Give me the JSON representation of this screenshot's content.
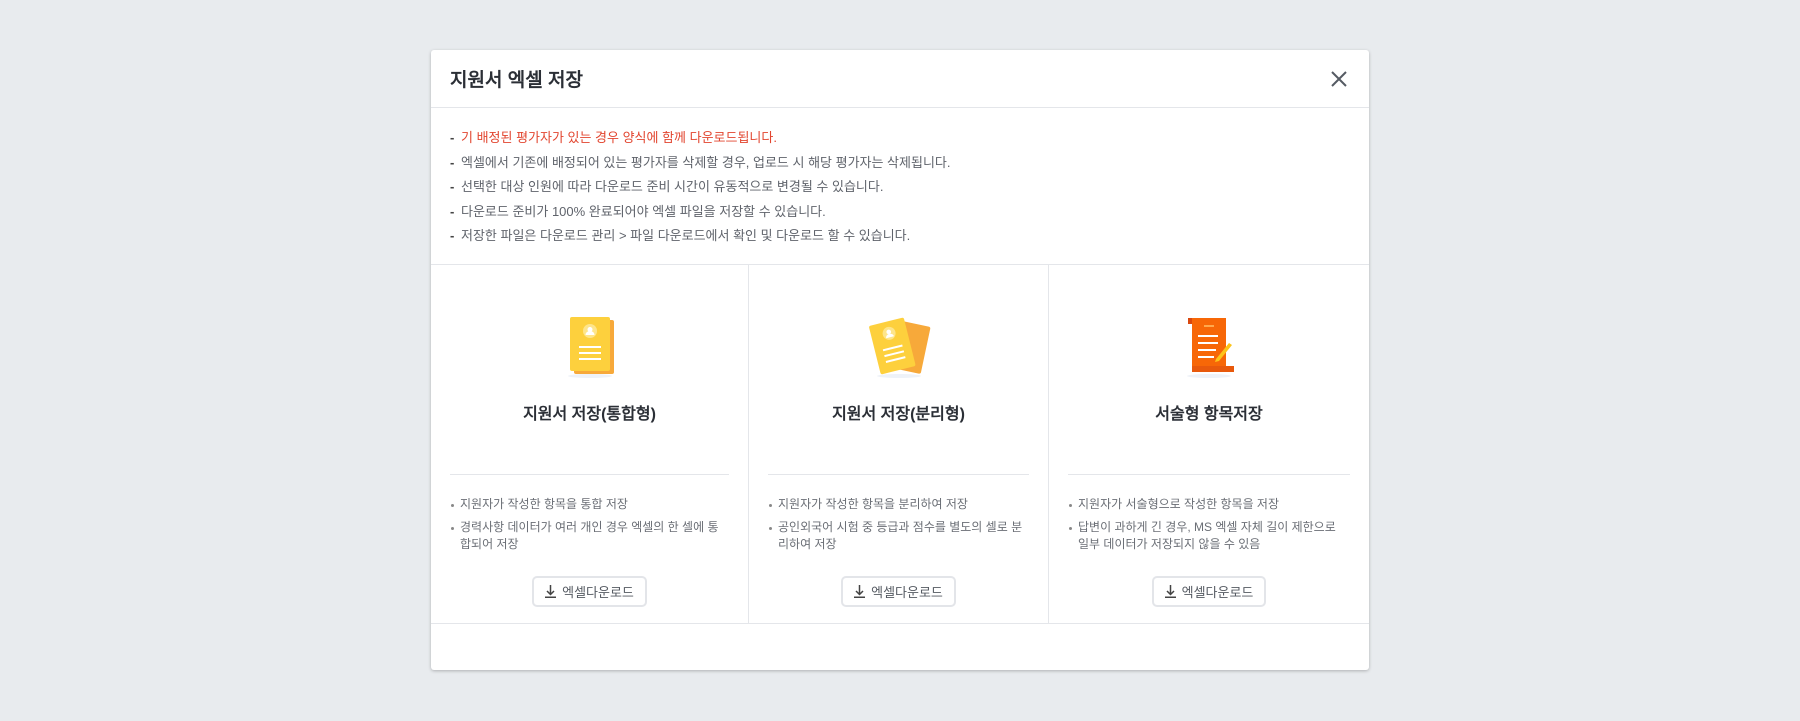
{
  "modal": {
    "title": "지원서 엑셀 저장",
    "close_icon": "close-icon"
  },
  "notices": [
    {
      "text": "기 배정된 평가자가 있는 경우 양식에 함께 다운로드됩니다.",
      "color": "#e2452f"
    },
    {
      "text": "엑셀에서 기존에 배정되어 있는 평가자를 삭제할 경우, 업로드 시 해당 평가자는 삭제됩니다."
    },
    {
      "text": "선택한 대상 인원에 따라 다운로드 준비 시간이 유동적으로 변경될 수 있습니다."
    },
    {
      "text": "다운로드 준비가 100% 완료되어야 엑셀 파일을 저장할 수 있습니다."
    },
    {
      "text": "저장한 파일은 다운로드 관리 > 파일 다운로드에서 확인 및 다운로드 할 수 있습니다."
    }
  ],
  "dash": "-",
  "options": [
    {
      "title": "지원서 저장(통합형)",
      "icon": "resume-document-icon",
      "bullets": [
        "지원자가 작성한 항목을 통합 저장",
        "경력사항 데이터가 여러 개인 경우 엑셀의 한 셀에 통합되어 저장"
      ],
      "button": "엑셀다운로드"
    },
    {
      "title": "지원서 저장(분리형)",
      "icon": "separated-documents-icon",
      "bullets": [
        "지원자가 작성한 항목을 분리하여 저장",
        "공인외국어 시험 중 등급과 점수를 별도의 셀로 분리하여 저장"
      ],
      "button": "엑셀다운로드"
    },
    {
      "title": "서술형 항목저장",
      "icon": "scroll-writing-icon",
      "bullets": [
        "지원자가 서술형으로 작성한 항목을 저장",
        "답변이 과하게 긴 경우, MS 엑셀 자체 길이 제한으로 일부 데이터가 저장되지 않을 수 있음"
      ],
      "button": "엑셀다운로드"
    }
  ]
}
